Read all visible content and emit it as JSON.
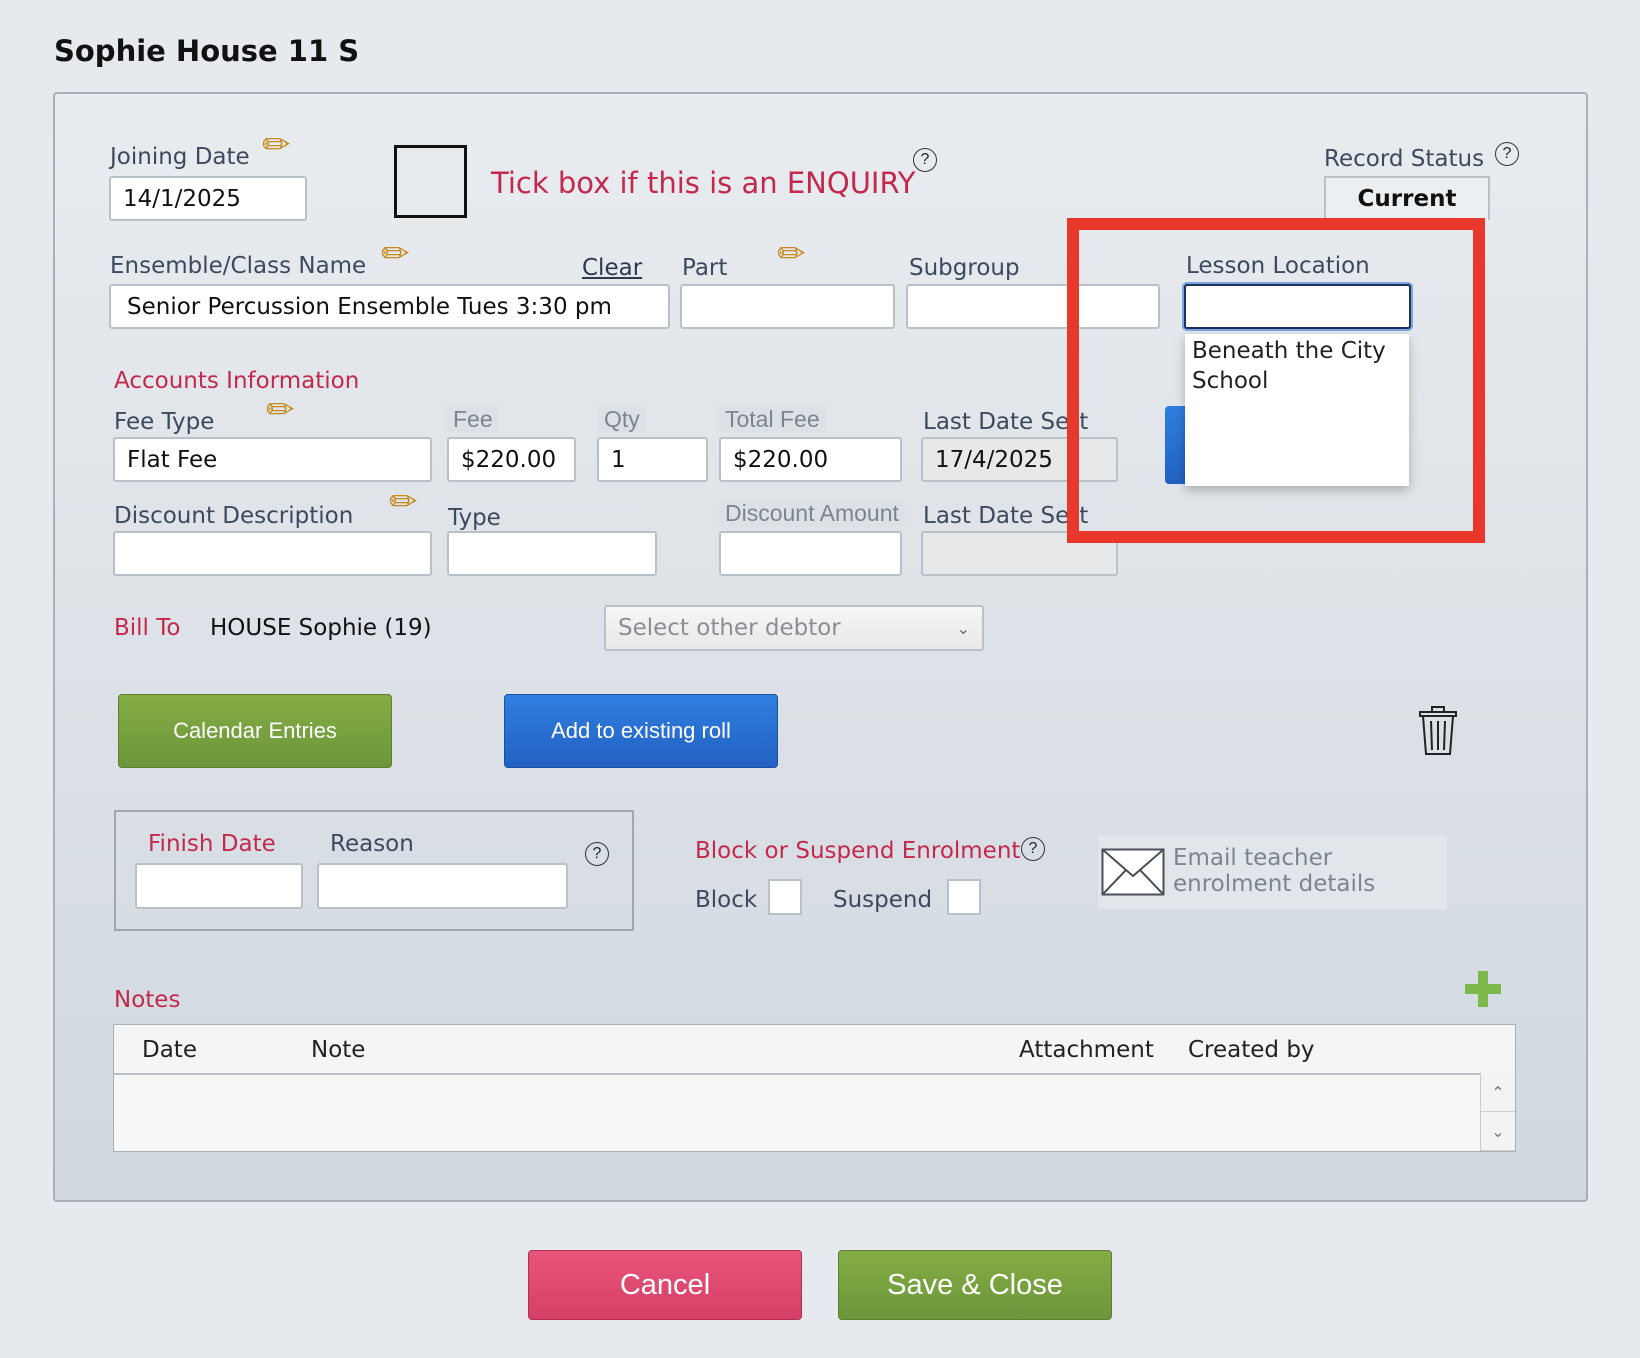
{
  "page": {
    "title": "Sophie House 11 S"
  },
  "enrolment": {
    "joining_date_label": "Joining Date",
    "joining_date": "14/1/2025",
    "enquiry_label": "Tick box if this is an ENQUIRY",
    "record_status_label": "Record Status",
    "record_status": "Current",
    "ensemble_label": "Ensemble/Class Name",
    "ensemble_clear": "Clear",
    "ensemble_value": "Senior Percussion Ensemble Tues 3:30 pm",
    "part_label": "Part",
    "subgroup_label": "Subgroup",
    "lesson_location_label": "Lesson Location",
    "lesson_location_value": "",
    "lesson_location_options": [
      "Beneath the City School"
    ]
  },
  "accounts": {
    "heading": "Accounts Information",
    "fee_type_label": "Fee Type",
    "fee_type": "Flat Fee",
    "fee_label": "Fee",
    "fee": "$220.00",
    "qty_label": "Qty",
    "qty": "1",
    "total_fee_label": "Total Fee",
    "total_fee": "$220.00",
    "last_date_sent_label": "Last Date Se",
    "last_date_sent_label_tail": "t",
    "last_date_sent": "17/4/2025",
    "discount_description_label": "Discount Description",
    "type_label": "Type",
    "discount_amount_label": "Discount Amount",
    "last_date_sent2_label": "Last Date Se",
    "last_date_sent2_label_tail": "t",
    "bill_to_label": "Bill To",
    "bill_to": "HOUSE Sophie (19)",
    "other_debtor_placeholder": "Select other debtor"
  },
  "actions": {
    "calendar_entries": "Calendar Entries",
    "add_to_roll": "Add to existing roll",
    "cancel": "Cancel",
    "save_close": "Save & Close"
  },
  "finish": {
    "finish_date_label": "Finish Date",
    "reason_label": "Reason"
  },
  "block": {
    "heading": "Block or Suspend Enrolment",
    "block_label": "Block",
    "suspend_label": "Suspend",
    "email_teacher_label": "Email teacher enrolment details"
  },
  "notes": {
    "heading": "Notes",
    "columns": [
      "Date",
      "Note",
      "Attachment",
      "Created by"
    ]
  },
  "colors": {
    "highlight": "#e8382b",
    "accent_red": "#c3294d",
    "green_button": "#6c963a",
    "blue_button": "#2261c2"
  },
  "icons": [
    "pencil-icon",
    "help-icon",
    "trash-icon",
    "envelope-icon",
    "plus-icon",
    "chevron-down-icon",
    "scroll-up-icon",
    "scroll-down-icon"
  ]
}
